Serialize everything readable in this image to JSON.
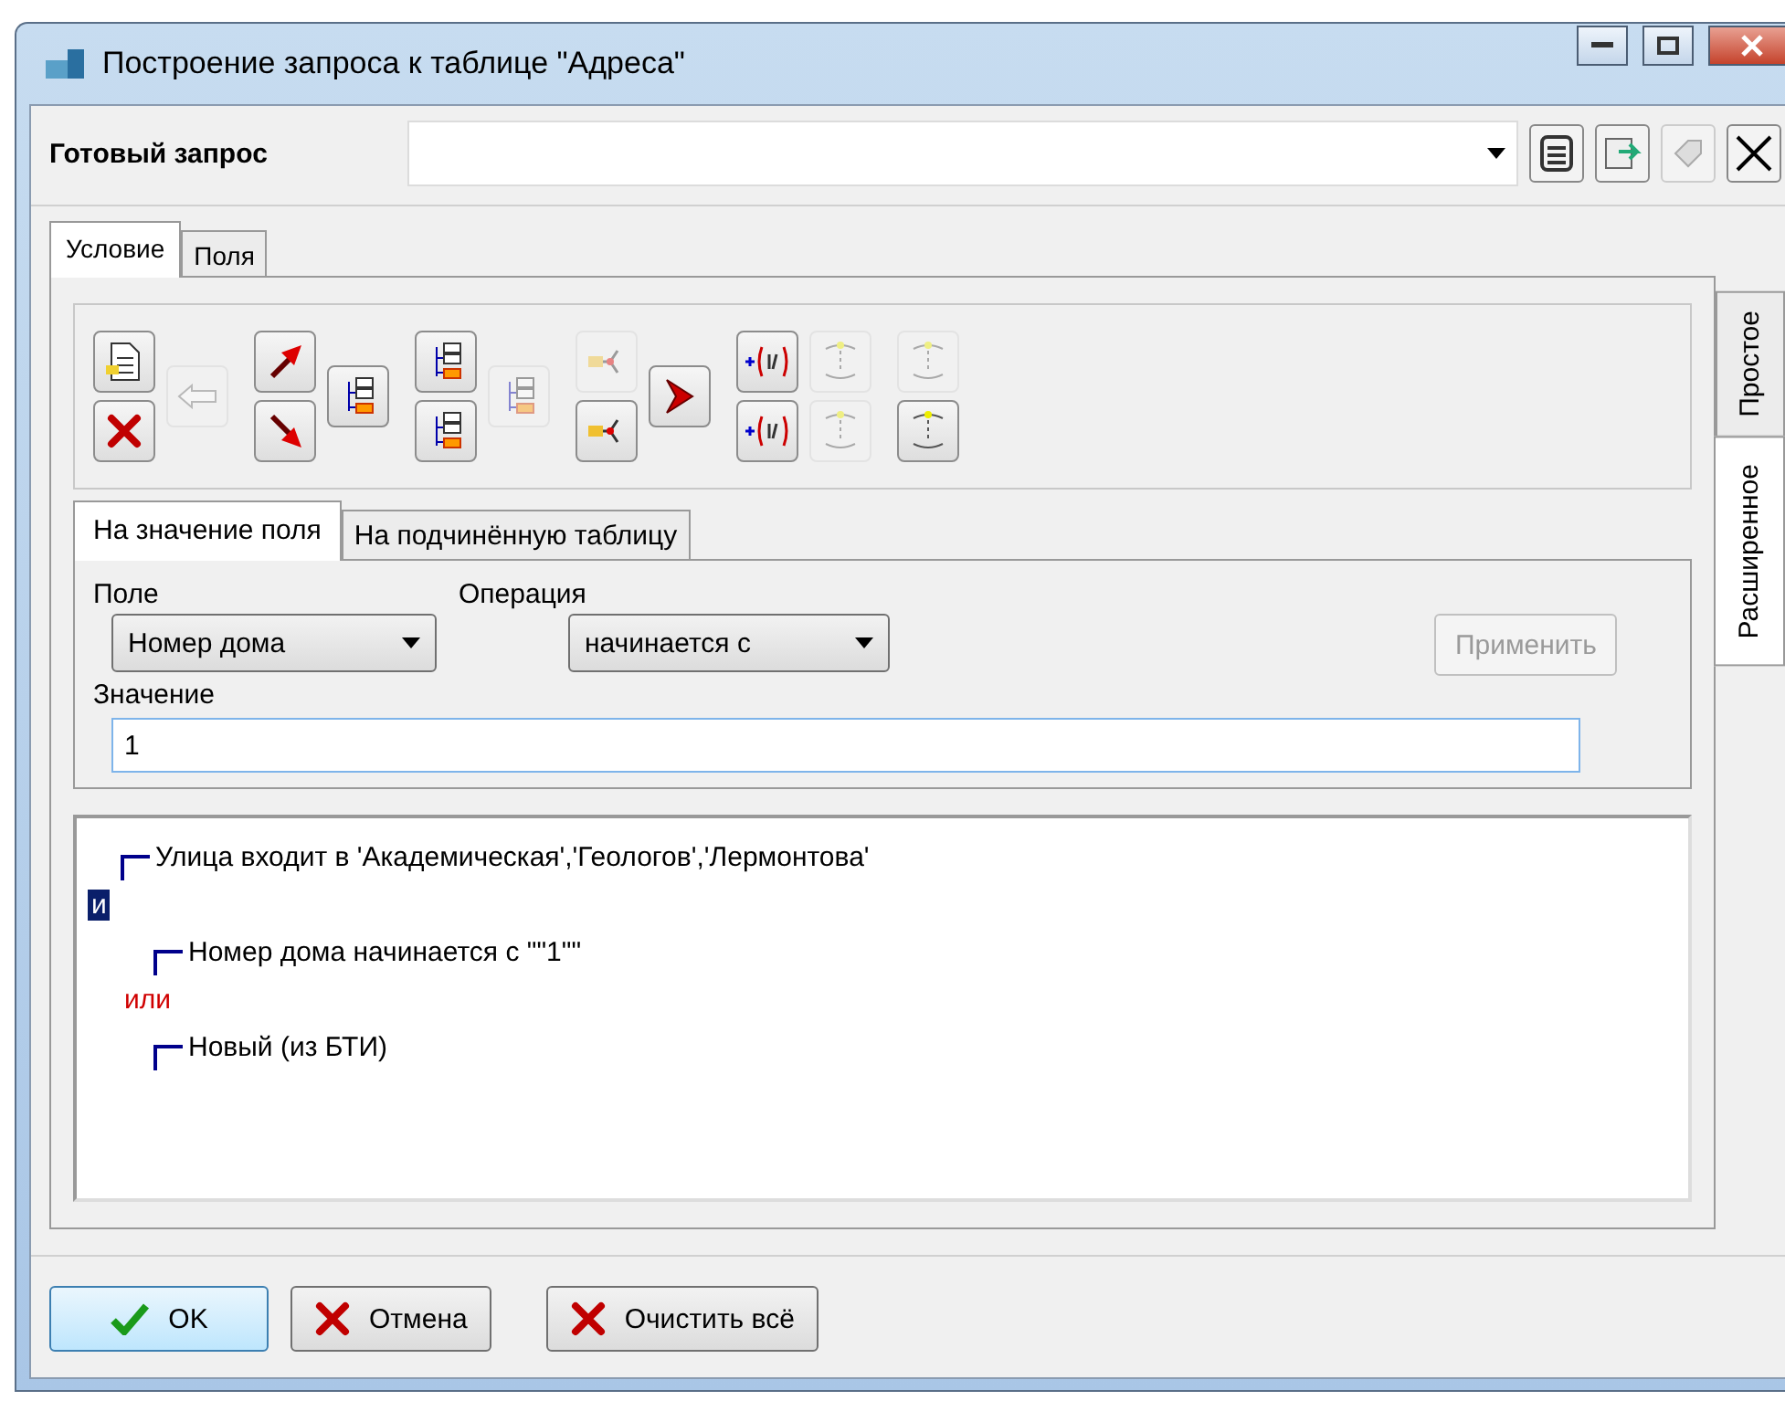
{
  "window": {
    "title": "Построение запроса к таблице \"Адреса\""
  },
  "ready_query": {
    "label": "Готовый запрос"
  },
  "query_actions": [
    {
      "kind": "save",
      "disabled": false
    },
    {
      "kind": "load",
      "disabled": false
    },
    {
      "kind": "tag",
      "disabled": true
    },
    {
      "kind": "clear",
      "disabled": false
    }
  ],
  "tabs": [
    {
      "label": "Условие",
      "selected": true
    },
    {
      "label": "Поля",
      "selected": false
    }
  ],
  "side_tabs": [
    {
      "label": "Простое",
      "selected": false
    },
    {
      "label": "Расширенное",
      "selected": true
    }
  ],
  "toolbar_columns": [
    [
      {
        "kind": "new",
        "disabled": false
      },
      {
        "kind": "delete",
        "disabled": false
      }
    ],
    [
      {
        "kind": "left",
        "disabled": true
      }
    ],
    [
      {
        "kind": "up",
        "disabled": false
      },
      {
        "kind": "down",
        "disabled": false
      }
    ],
    [
      {
        "kind": "tree",
        "disabled": false
      }
    ],
    [
      {
        "kind": "tree",
        "disabled": false
      },
      {
        "kind": "tree",
        "disabled": false
      }
    ],
    [
      {
        "kind": "tree",
        "disabled": true
      }
    ],
    [
      {
        "kind": "branch",
        "disabled": true
      },
      {
        "kind": "branch",
        "disabled": false
      }
    ],
    [
      {
        "kind": "chevron",
        "disabled": false
      }
    ],
    [
      {
        "kind": "range",
        "disabled": false
      },
      {
        "kind": "range",
        "disabled": false
      }
    ],
    [
      {
        "kind": "bracket",
        "disabled": true
      },
      {
        "kind": "bracket",
        "disabled": true
      }
    ],
    [
      {
        "kind": "bracket",
        "disabled": true
      },
      {
        "kind": "bracket",
        "disabled": false
      }
    ]
  ],
  "inner_tabs": [
    {
      "label": "На значение поля",
      "selected": true
    },
    {
      "label": "На подчинённую таблицу",
      "selected": false
    }
  ],
  "form": {
    "field_label": "Поле",
    "field_value": "Номер дома",
    "operation_label": "Операция",
    "operation_value": "начинается с",
    "apply": {
      "label": "Применить",
      "disabled": true
    },
    "value_label": "Значение",
    "value": "1"
  },
  "tree": {
    "kind": "operator",
    "label": "и",
    "selected": true,
    "children": [
      {
        "kind": "condition",
        "label": "Улица входит в 'Академическая','Геологов','Лермонтова'",
        "selected": false
      },
      {
        "kind": "operator",
        "label": "или",
        "selected": false,
        "children": [
          {
            "kind": "condition",
            "label": "Номер дома начинается с \"\"1\"\"",
            "selected": false
          },
          {
            "kind": "condition",
            "label": "Новый (из БТИ)",
            "selected": false
          }
        ]
      }
    ]
  },
  "buttons": [
    {
      "kind": "ok",
      "label": "OK"
    },
    {
      "kind": "cancel",
      "label": "Отмена"
    },
    {
      "kind": "cancel",
      "label": "Очистить всё"
    }
  ]
}
